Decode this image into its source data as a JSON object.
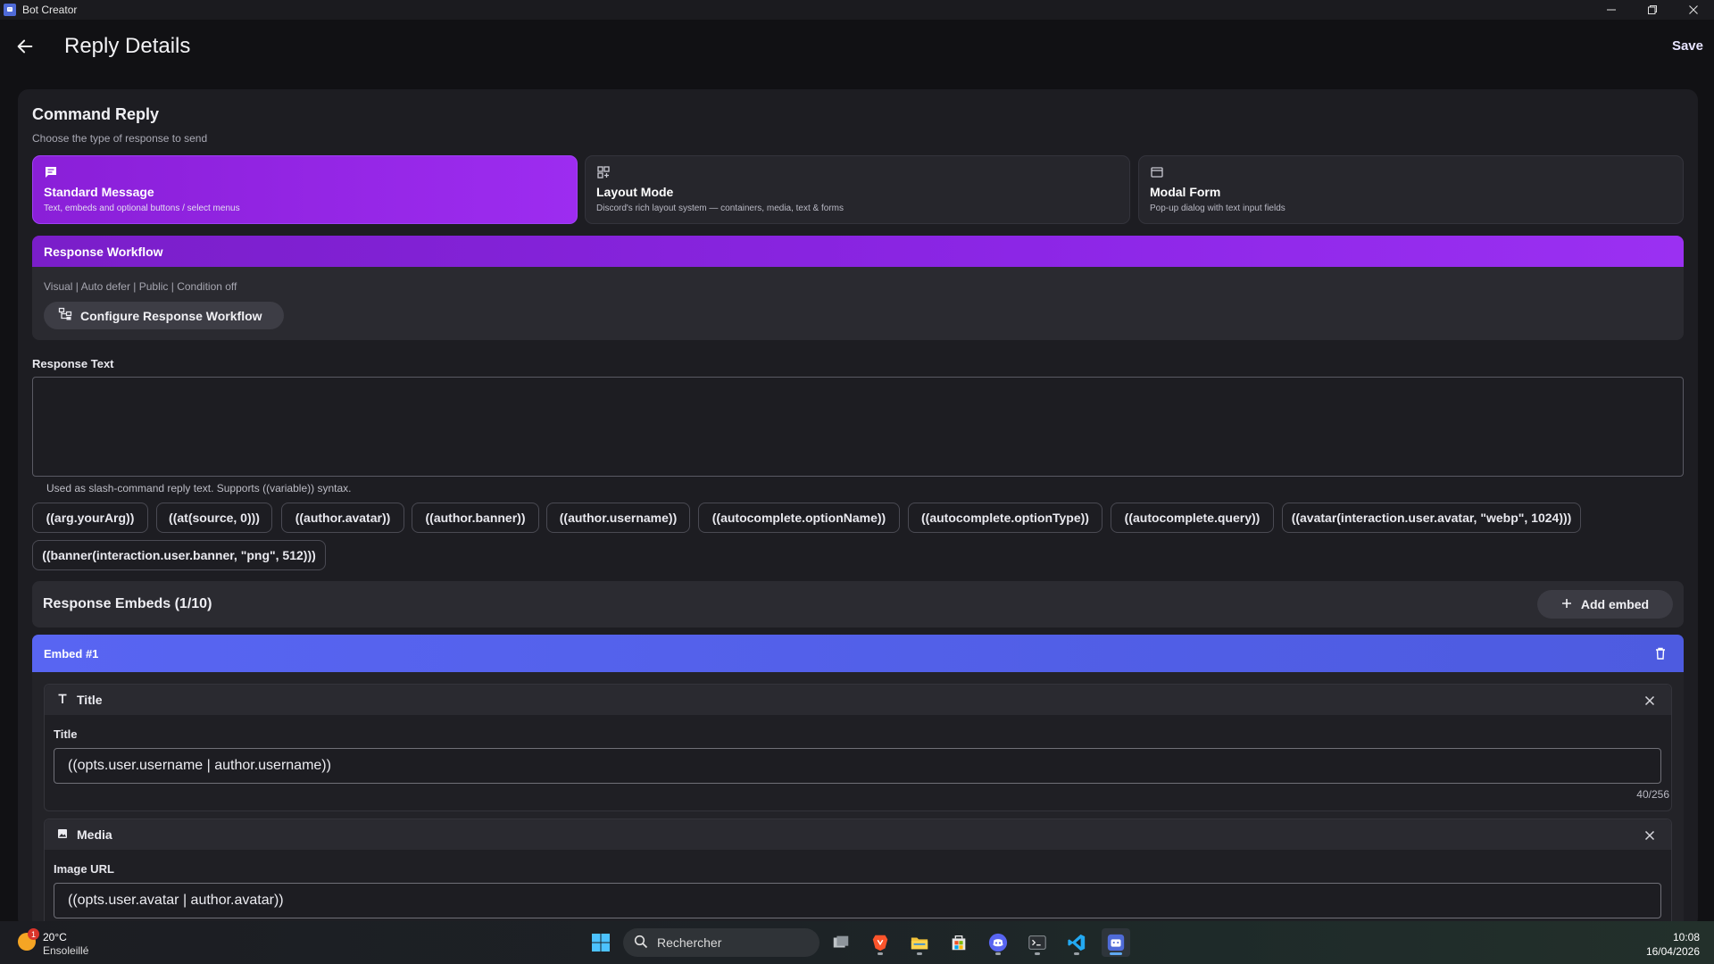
{
  "window": {
    "title": "Bot Creator"
  },
  "header": {
    "title": "Reply Details",
    "save_label": "Save"
  },
  "command_reply": {
    "title": "Command Reply",
    "subtitle": "Choose the type of response to send",
    "types": [
      {
        "title": "Standard Message",
        "desc": "Text, embeds and optional buttons / select menus",
        "icon": "message-icon",
        "selected": true
      },
      {
        "title": "Layout Mode",
        "desc": "Discord's rich layout system — containers, media, text & forms",
        "icon": "layout-icon",
        "selected": false
      },
      {
        "title": "Modal Form",
        "desc": "Pop-up dialog with text input fields",
        "icon": "modal-icon",
        "selected": false
      }
    ]
  },
  "workflow": {
    "title": "Response Workflow",
    "status": "Visual | Auto defer | Public | Condition off",
    "button_label": "Configure Response Workflow"
  },
  "response_text": {
    "label": "Response Text",
    "value": "",
    "help": "Used as slash-command reply text. Supports ((variable)) syntax.",
    "variables": [
      "((arg.yourArg))",
      "((at(source, 0)))",
      "((author.avatar))",
      "((author.banner))",
      "((author.username))",
      "((autocomplete.optionName))",
      "((autocomplete.optionType))",
      "((autocomplete.query))",
      "((avatar(interaction.user.avatar, \"webp\", 1024)))",
      "((banner(interaction.user.banner, \"png\", 512)))"
    ]
  },
  "embeds": {
    "title": "Response Embeds (1/10)",
    "add_label": "Add embed",
    "items": [
      {
        "header": "Embed #1",
        "title_section": {
          "name": "Title",
          "label": "Title",
          "value": "((opts.user.username | author.username))",
          "counter": "40/256"
        },
        "media_section": {
          "name": "Media",
          "label": "Image URL",
          "value": "((opts.user.avatar | author.avatar))"
        }
      }
    ]
  },
  "taskbar": {
    "weather_temp": "20°C",
    "weather_cond": "Ensoleillé",
    "weather_badge": "1",
    "search_placeholder": "Rechercher",
    "time": "10:08",
    "date": "16/04/2026"
  },
  "colors": {
    "accent_purple": "#9b30f2",
    "embed_blue": "#5865f2",
    "background": "#111114",
    "card": "#1d1d22"
  }
}
